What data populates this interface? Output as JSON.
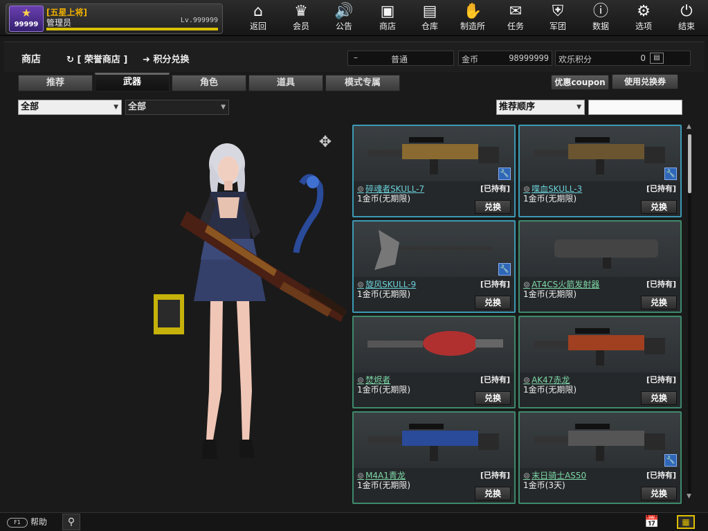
{
  "player": {
    "rank_number": "99999",
    "title": "[五星上将]",
    "name": "管理员",
    "level": "Lv.999999",
    "xp_fraction": 1.0
  },
  "nav": [
    {
      "label": "返回",
      "icon": "home-icon",
      "glyph": "⌂"
    },
    {
      "label": "会员",
      "icon": "crown-icon",
      "glyph": "♛"
    },
    {
      "label": "公告",
      "icon": "speaker-icon",
      "glyph": "🔊"
    },
    {
      "label": "商店",
      "icon": "shop-bag-icon",
      "glyph": "▣"
    },
    {
      "label": "仓库",
      "icon": "briefcase-icon",
      "glyph": "▤"
    },
    {
      "label": "制造所",
      "icon": "glove-icon",
      "glyph": "✋"
    },
    {
      "label": "任务",
      "icon": "ticket-icon",
      "glyph": "✉"
    },
    {
      "label": "军团",
      "icon": "shield-icon",
      "glyph": "⛨"
    },
    {
      "label": "数据",
      "icon": "info-icon",
      "glyph": "ⓘ"
    },
    {
      "label": "选项",
      "icon": "gear-icon",
      "glyph": "⚙"
    },
    {
      "label": "结束",
      "icon": "power-icon",
      "glyph": "⏻"
    }
  ],
  "shopbar": {
    "title": "商店",
    "honor_shop": "[ 荣誉商店 ]",
    "points_exchange": "积分兑换",
    "mode_dash": "–",
    "mode": "普通",
    "coin_label": "金币",
    "coin_value": "98999999",
    "fun_label": "欢乐积分",
    "fun_value": "0"
  },
  "tabs": [
    "推荐",
    "武器",
    "角色",
    "道具",
    "模式专属"
  ],
  "active_tab": 1,
  "buttons": {
    "coupon": "优惠coupon",
    "redeem": "使用兑换券"
  },
  "filters": {
    "filter1": "全部",
    "filter2": "全部",
    "sort": "推荐顺序",
    "search_value": ""
  },
  "items": [
    {
      "name": "碎魂者SKULL-7",
      "owned": "[已持有]",
      "price": "1金币(无期限)",
      "buy": "兑换",
      "wrench": true,
      "border": "blue",
      "kind": "mg"
    },
    {
      "name": "喋血SKULL-3",
      "owned": "[已持有]",
      "price": "1金币(无期限)",
      "buy": "兑换",
      "wrench": true,
      "border": "blue",
      "kind": "smg"
    },
    {
      "name": "旋风SKULL-9",
      "owned": "[已持有]",
      "price": "1金币(无期限)",
      "buy": "兑换",
      "wrench": true,
      "border": "blue",
      "kind": "axe"
    },
    {
      "name": "AT4CS火箭发射器",
      "owned": "[已持有]",
      "price": "1金币(无期限)",
      "buy": "兑换",
      "wrench": false,
      "border": "green",
      "kind": "launcher"
    },
    {
      "name": "焚烬者",
      "owned": "[已持有]",
      "price": "1金币(无期限)",
      "buy": "兑换",
      "wrench": false,
      "border": "green",
      "kind": "flamer"
    },
    {
      "name": "AK47赤龙",
      "owned": "[已持有]",
      "price": "1金币(无期限)",
      "buy": "兑换",
      "wrench": false,
      "border": "green",
      "kind": "ak"
    },
    {
      "name": "M4A1青龙",
      "owned": "[已持有]",
      "price": "1金币(无期限)",
      "buy": "兑换",
      "wrench": false,
      "border": "green",
      "kind": "m4"
    },
    {
      "name": "末日骑士AS50",
      "owned": "[已持有]",
      "price": "1金币(3天)",
      "buy": "兑换",
      "wrench": true,
      "border": "green",
      "kind": "sniper"
    }
  ],
  "bottombar": {
    "help_key": "F1",
    "help": "帮助"
  }
}
